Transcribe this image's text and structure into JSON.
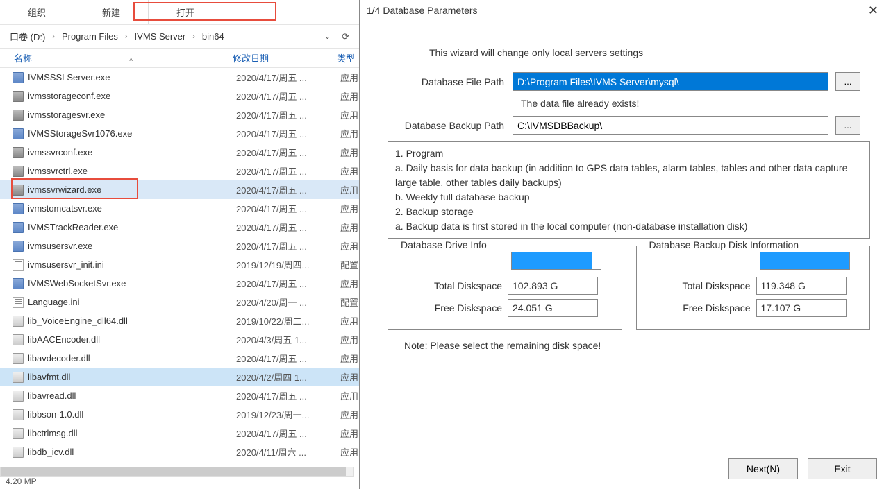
{
  "tabs": [
    "组织",
    "新建",
    "打开"
  ],
  "breadcrumb": [
    "口卷 (D:)",
    "Program Files",
    "IVMS Server",
    "bin64"
  ],
  "columns": {
    "name": "名称",
    "date": "修改日期",
    "type": "类型"
  },
  "files": [
    {
      "icon": "exe",
      "name": "IVMSSSLServer.exe",
      "date": "2020/4/17/周五 ...",
      "type": "应用"
    },
    {
      "icon": "exe2",
      "name": "ivmsstorageconf.exe",
      "date": "2020/4/17/周五 ...",
      "type": "应用"
    },
    {
      "icon": "exe2",
      "name": "ivmsstoragesvr.exe",
      "date": "2020/4/17/周五 ...",
      "type": "应用"
    },
    {
      "icon": "exe",
      "name": "IVMSStorageSvr1076.exe",
      "date": "2020/4/17/周五 ...",
      "type": "应用"
    },
    {
      "icon": "exe2",
      "name": "ivmssvrconf.exe",
      "date": "2020/4/17/周五 ...",
      "type": "应用"
    },
    {
      "icon": "exe2",
      "name": "ivmssvrctrl.exe",
      "date": "2020/4/17/周五 ...",
      "type": "应用"
    },
    {
      "icon": "exe2",
      "name": "ivmssvrwizard.exe",
      "date": "2020/4/17/周五 ...",
      "type": "应用",
      "selected": true
    },
    {
      "icon": "exe",
      "name": "ivmstomcatsvr.exe",
      "date": "2020/4/17/周五 ...",
      "type": "应用"
    },
    {
      "icon": "exe",
      "name": "IVMSTrackReader.exe",
      "date": "2020/4/17/周五 ...",
      "type": "应用"
    },
    {
      "icon": "exe",
      "name": "ivmsusersvr.exe",
      "date": "2020/4/17/周五 ...",
      "type": "应用"
    },
    {
      "icon": "ini",
      "name": "ivmsusersvr_init.ini",
      "date": "2019/12/19/周四...",
      "type": "配置"
    },
    {
      "icon": "exe",
      "name": "IVMSWebSocketSvr.exe",
      "date": "2020/4/17/周五 ...",
      "type": "应用"
    },
    {
      "icon": "ini",
      "name": "Language.ini",
      "date": "2020/4/20/周一 ...",
      "type": "配置"
    },
    {
      "icon": "dll",
      "name": "lib_VoiceEngine_dll64.dll",
      "date": "2019/10/22/周二...",
      "type": "应用"
    },
    {
      "icon": "dll",
      "name": "libAACEncoder.dll",
      "date": "2020/4/3/周五 1...",
      "type": "应用"
    },
    {
      "icon": "dll",
      "name": "libavdecoder.dll",
      "date": "2020/4/17/周五 ...",
      "type": "应用"
    },
    {
      "icon": "dll",
      "name": "libavfmt.dll",
      "date": "2020/4/2/周四 1...",
      "type": "应用",
      "sel2": true
    },
    {
      "icon": "dll",
      "name": "libavread.dll",
      "date": "2020/4/17/周五 ...",
      "type": "应用"
    },
    {
      "icon": "dll",
      "name": "libbson-1.0.dll",
      "date": "2019/12/23/周一...",
      "type": "应用"
    },
    {
      "icon": "dll",
      "name": "libctrlmsg.dll",
      "date": "2020/4/17/周五 ...",
      "type": "应用"
    },
    {
      "icon": "dll",
      "name": "libdb_icv.dll",
      "date": "2020/4/11/周六 ...",
      "type": "应用"
    }
  ],
  "status": "4.20 MP",
  "dialog": {
    "title": "1/4  Database Parameters",
    "intro": "This wizard will change only local servers settings",
    "db_path_label": "Database File Path",
    "db_path_value": "D:\\Program Files\\IVMS Server\\mysql\\",
    "exists_warn": "The data file already exists!",
    "backup_label": "Database Backup Path",
    "backup_value": "C:\\IVMSDBBackup\\",
    "browse": "...",
    "info_lines": [
      "1. Program",
      "  a. Daily basis for data backup (in addition to GPS data tables, alarm tables, tables and other data capture large table, other tables daily backups)",
      "  b. Weekly full database backup",
      "2. Backup storage",
      "  a. Backup data is first stored in the local computer (non-database installation disk)"
    ],
    "drive_info_legend": "Database Drive Info",
    "backup_info_legend": "Database Backup Disk Information",
    "total_label": "Total Diskspace",
    "free_label": "Free Diskspace",
    "drive": {
      "total": "102.893 G",
      "free": "24.051 G",
      "fill_pct": 90
    },
    "backup": {
      "total": "119.348 G",
      "free": "17.107 G",
      "fill_pct": 100
    },
    "note": "Note: Please select the remaining disk space!",
    "next_btn": "Next(N)",
    "exit_btn": "Exit"
  }
}
